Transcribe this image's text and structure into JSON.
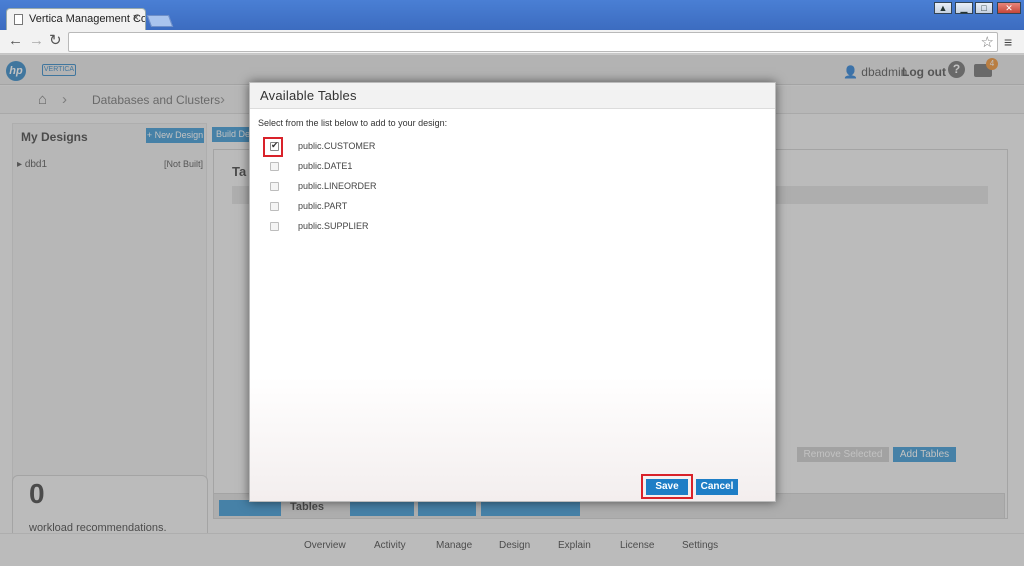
{
  "browser": {
    "tab_title": "Vertica Management Co",
    "tab_close": "×",
    "address": ""
  },
  "app": {
    "user": "dbadmin",
    "logout": "Log out",
    "help": "?",
    "mail_count": "4",
    "breadcrumb": "Databases and Clusters",
    "left_panel": {
      "title": "My Designs",
      "new_design": "+ New Design",
      "design_name": "dbd1",
      "design_status": "[Not Built]"
    },
    "build_design": "Build De",
    "workload": {
      "count": "0",
      "label": "workload recommendations."
    },
    "main_heading": "Ta",
    "remove_selected": "Remove Selected",
    "add_tables": "Add Tables",
    "active_tab": "Tables",
    "footer": [
      "Overview",
      "Activity",
      "Manage",
      "Design",
      "Explain",
      "License",
      "Settings"
    ]
  },
  "dialog": {
    "title": "Available Tables",
    "instructions": "Select from the list below to add to your design:",
    "tables": [
      {
        "name": "public.CUSTOMER",
        "checked": true
      },
      {
        "name": "public.DATE1",
        "checked": false
      },
      {
        "name": "public.LINEORDER",
        "checked": false
      },
      {
        "name": "public.PART",
        "checked": false
      },
      {
        "name": "public.SUPPLIER",
        "checked": false
      }
    ],
    "save": "Save",
    "cancel": "Cancel"
  },
  "colors": {
    "accent": "#1e7ec6",
    "highlight": "#d9222a"
  }
}
